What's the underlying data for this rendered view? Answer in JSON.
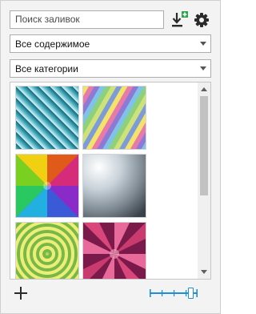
{
  "search": {
    "placeholder": "Поиск заливок"
  },
  "filters": {
    "content": "Все содержимое",
    "category": "Все категории"
  },
  "icons": {
    "import": "download-plus-icon",
    "settings": "gear-icon",
    "add": "plus-icon",
    "zoom": "thumbnail-size-slider"
  },
  "colors": {
    "accent": "#1e8fd6",
    "dark": "#2b2b2b",
    "green": "#2ea44f"
  },
  "zoom": {
    "level": 0.9
  }
}
